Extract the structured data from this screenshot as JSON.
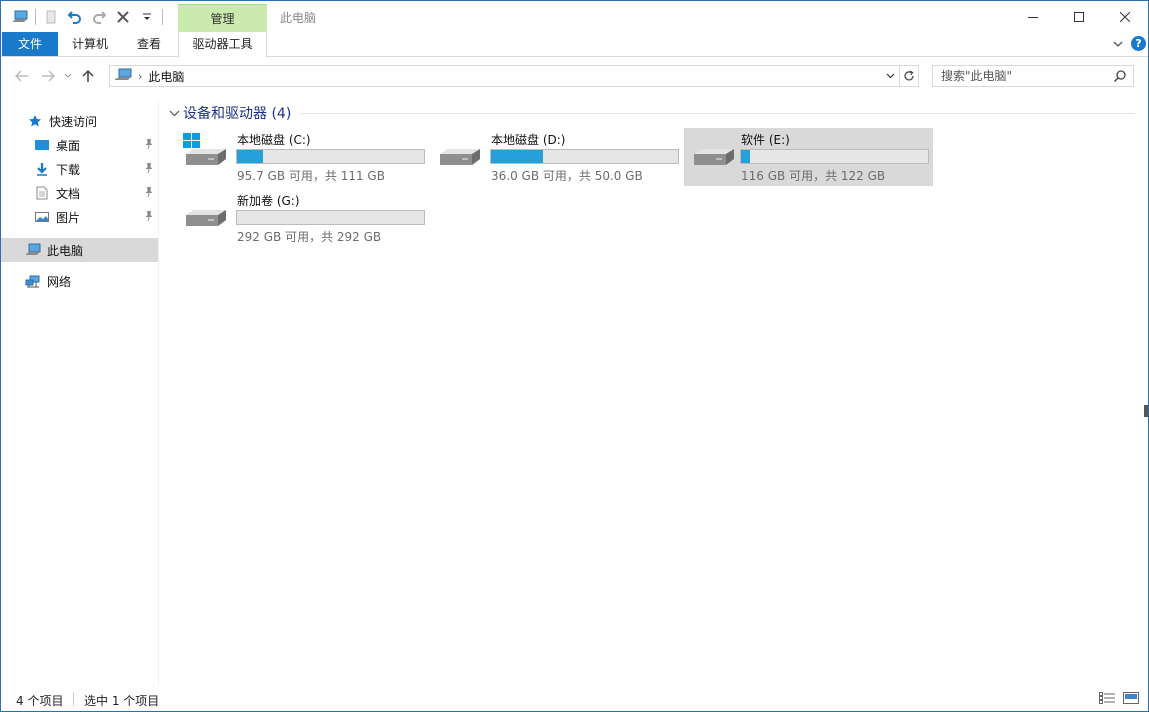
{
  "titlebar": {
    "context_tab_head": "管理",
    "window_title": "此电脑"
  },
  "ribbon": {
    "tabs": [
      "文件",
      "计算机",
      "查看",
      "驱动器工具"
    ]
  },
  "address": {
    "crumb": "此电脑"
  },
  "search": {
    "placeholder": "搜索\"此电脑\""
  },
  "navpane": {
    "quick_access": "快速访问",
    "pinned": [
      "桌面",
      "下载",
      "文档",
      "图片"
    ],
    "this_pc": "此电脑",
    "network": "网络"
  },
  "group": {
    "title": "设备和驱动器 (4)"
  },
  "drives": [
    {
      "name": "本地磁盘 (C:)",
      "info": "95.7 GB 可用，共 111 GB",
      "used_percent": 14,
      "icon": "windows-drive-icon"
    },
    {
      "name": "本地磁盘 (D:)",
      "info": "36.0 GB 可用，共 50.0 GB",
      "used_percent": 28,
      "icon": "drive-icon"
    },
    {
      "name": "软件 (E:)",
      "info": "116 GB 可用，共 122 GB",
      "used_percent": 5,
      "icon": "drive-icon"
    },
    {
      "name": "新加卷 (G:)",
      "info": "292 GB 可用，共 292 GB",
      "used_percent": 0,
      "icon": "drive-icon"
    }
  ],
  "statusbar": {
    "count": "4 个项目",
    "selected": "选中 1 个项目"
  },
  "colors": {
    "accent": "#1979ca",
    "context_tab": "#cbeaae",
    "bar_fill": "#26a0da",
    "selected_bg": "#d9d9d9",
    "group_title": "#1e3287"
  }
}
